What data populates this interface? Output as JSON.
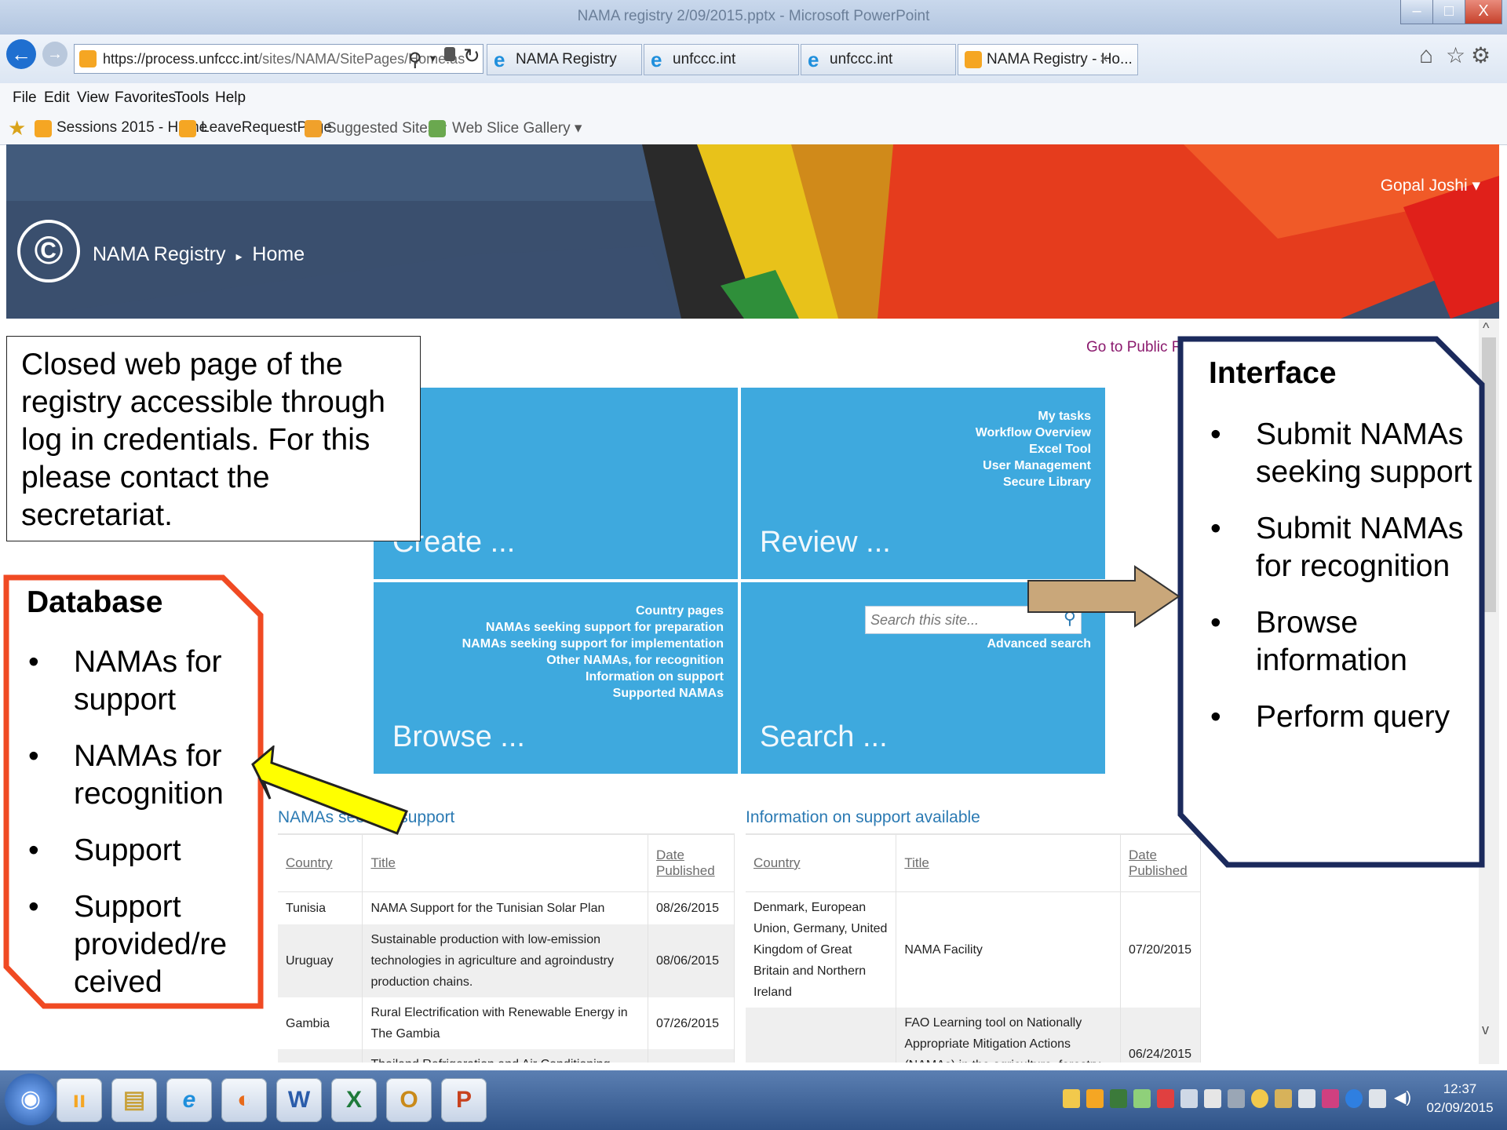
{
  "window": {
    "title": "NAMA registry 2/09/2015.pptx - Microsoft PowerPoint",
    "controls": [
      "–",
      "□",
      "X"
    ]
  },
  "browser": {
    "back_label": "←",
    "forward_label": "→",
    "url": "https://process.unfccc.int/sites/NAMA/SitePages/Home.as",
    "url_host": "https://process.unfccc.int",
    "url_path": "/sites/NAMA/SitePages/Home.as",
    "tabs": [
      {
        "label": "NAMA Registry",
        "icon": "ie-icon"
      },
      {
        "label": "unfccc.int",
        "icon": "ie-icon"
      },
      {
        "label": "unfccc.int",
        "icon": "ie-icon"
      },
      {
        "label": "NAMA Registry - Ho...",
        "icon": "sharepoint-icon",
        "active": true
      }
    ],
    "tab_close": "×",
    "menu": [
      "File",
      "Edit",
      "View",
      "Favorites",
      "Tools",
      "Help"
    ],
    "favorites": [
      {
        "label": "Sessions 2015 - Home"
      },
      {
        "label": "LeaveRequestPage"
      },
      {
        "label": "Suggested Sites ▾"
      },
      {
        "label": "Web Slice Gallery ▾"
      }
    ]
  },
  "site": {
    "user": "Gopal Joshi ▾",
    "breadcrumb_root": "NAMA Registry",
    "breadcrumb_sep": "▸",
    "breadcrumb_current": "Home",
    "public_link": "Go to Public Reg",
    "tiles": {
      "create": {
        "title": "Create ..."
      },
      "review": {
        "title": "Review ...",
        "links": [
          "My tasks",
          "Workflow Overview",
          "Excel Tool",
          "User Management",
          "Secure Library"
        ]
      },
      "browse": {
        "title": "Browse ...",
        "links": [
          "Country pages",
          "NAMAs seeking support for preparation",
          "NAMAs seeking support for implementation",
          "Other NAMAs, for recognition",
          "Information on support",
          "Supported NAMAs"
        ]
      },
      "search": {
        "title": "Search ...",
        "placeholder": "Search this site...",
        "advanced": "Advanced search"
      }
    },
    "left_table": {
      "title": "NAMAs seeking support",
      "headers": {
        "country": "Country",
        "title": "Title",
        "date_line1": "Date",
        "date_line2": "Published"
      },
      "rows": [
        {
          "country": "Tunisia",
          "title": "NAMA Support for the Tunisian Solar Plan",
          "date": "08/26/2015"
        },
        {
          "country": "Uruguay",
          "title": "Sustainable production with low-emission technologies in agriculture and agroindustry production chains.",
          "date": "08/06/2015"
        },
        {
          "country": "Gambia",
          "title": "Rural Electrification with Renewable Energy in The Gambia",
          "date": "07/26/2015"
        },
        {
          "country": "",
          "title": "Thailand Refrigeration and Air Conditioning NAMA",
          "date": ""
        }
      ]
    },
    "right_table": {
      "title": "Information on support available",
      "headers": {
        "country": "Country",
        "title": "Title",
        "date_line1": "Date",
        "date_line2": "Published"
      },
      "rows": [
        {
          "country": "Denmark, European Union, Germany, United Kingdom of Great Britain and Northern Ireland",
          "title": "NAMA Facility",
          "date": "07/20/2015"
        },
        {
          "country": "",
          "title": "FAO Learning tool on Nationally Appropriate Mitigation Actions (NAMAs) in the agriculture, forestry and other land use (AFOLU) sector",
          "date": "06/24/2015"
        }
      ]
    }
  },
  "annotations": {
    "closed_note": "Closed web page of the registry accessible through log in credentials. For this please contact the secretariat.",
    "database": {
      "heading": "Database",
      "items": [
        "NAMAs for support",
        "NAMAs for recognition",
        "Support",
        "Support provided/re ceived"
      ]
    },
    "interface": {
      "heading": "Interface",
      "items": [
        "Submit NAMAs seeking support",
        "Submit NAMAs for recognition",
        "Browse information",
        "Perform query"
      ]
    },
    "bullet": "•"
  },
  "taskbar": {
    "time": "12:37",
    "date": "02/09/2015",
    "apps": [
      "start-orb",
      "sharepoint",
      "explorer",
      "internet-explorer",
      "firefox",
      "word",
      "excel",
      "outlook",
      "powerpoint"
    ],
    "app_glyphs": [
      "◉",
      "ıı",
      "▤",
      "e",
      "◐",
      "W",
      "X",
      "O",
      "P"
    ]
  },
  "colors": {
    "tile_blue": "#3ea9de",
    "database_border": "#f04a23",
    "interface_border": "#1b2a5c",
    "yellow_arrow": "#ffff00",
    "tan_arrow": "#c9a77a",
    "link_purple": "#8b1a6e",
    "section_blue": "#2b7ab3"
  }
}
